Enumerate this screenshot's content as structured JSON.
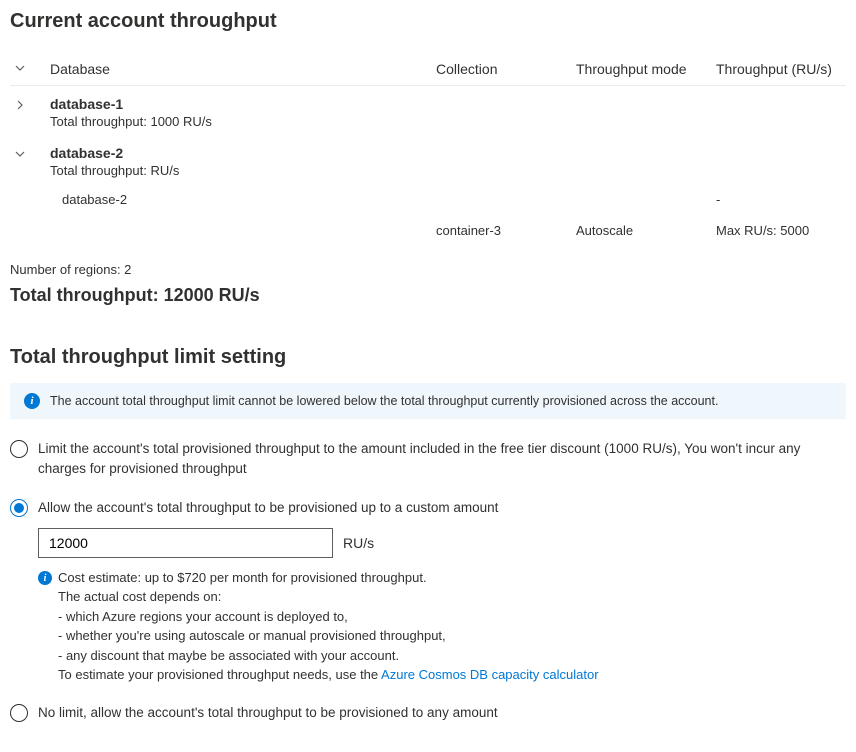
{
  "title": "Current account throughput",
  "columns": {
    "database": "Database",
    "collection": "Collection",
    "mode": "Throughput mode",
    "throughput": "Throughput (RU/s)"
  },
  "databases": [
    {
      "name": "database-1",
      "subtext": "Total throughput: 1000 RU/s",
      "expanded": false
    },
    {
      "name": "database-2",
      "subtext": "Total throughput: RU/s",
      "expanded": true,
      "rows": [
        {
          "db": "database-2",
          "collection": "",
          "mode": "",
          "throughput": "-"
        },
        {
          "db": "",
          "collection": "container-3",
          "mode": "Autoscale",
          "throughput": "Max RU/s: 5000"
        }
      ]
    }
  ],
  "regions_label": "Number of regions: 2",
  "total_label": "Total throughput: 12000 RU/s",
  "limit_section": {
    "title": "Total throughput limit setting",
    "banner": "The account total throughput limit cannot be lowered below the total throughput currently provisioned across the account.",
    "option1": "Limit the account's total provisioned throughput to the amount included in the free tier discount (1000 RU/s), You won't incur any charges for provisioned throughput",
    "option2": "Allow the account's total throughput to be provisioned up to a custom amount",
    "custom_value": "12000",
    "custom_unit": "RU/s",
    "cost_line1": "Cost estimate: up to $720 per month for provisioned throughput.",
    "cost_line2": "The actual cost depends on:",
    "cost_line3": "- which Azure regions your account is deployed to,",
    "cost_line4": "- whether you're using autoscale or manual provisioned throughput,",
    "cost_line5": "- any discount that maybe be associated with your account.",
    "cost_line6": "To estimate your provisioned throughput needs, use the ",
    "cost_link": "Azure Cosmos DB capacity calculator",
    "option3": "No limit, allow the account's total throughput to be provisioned to any amount"
  }
}
